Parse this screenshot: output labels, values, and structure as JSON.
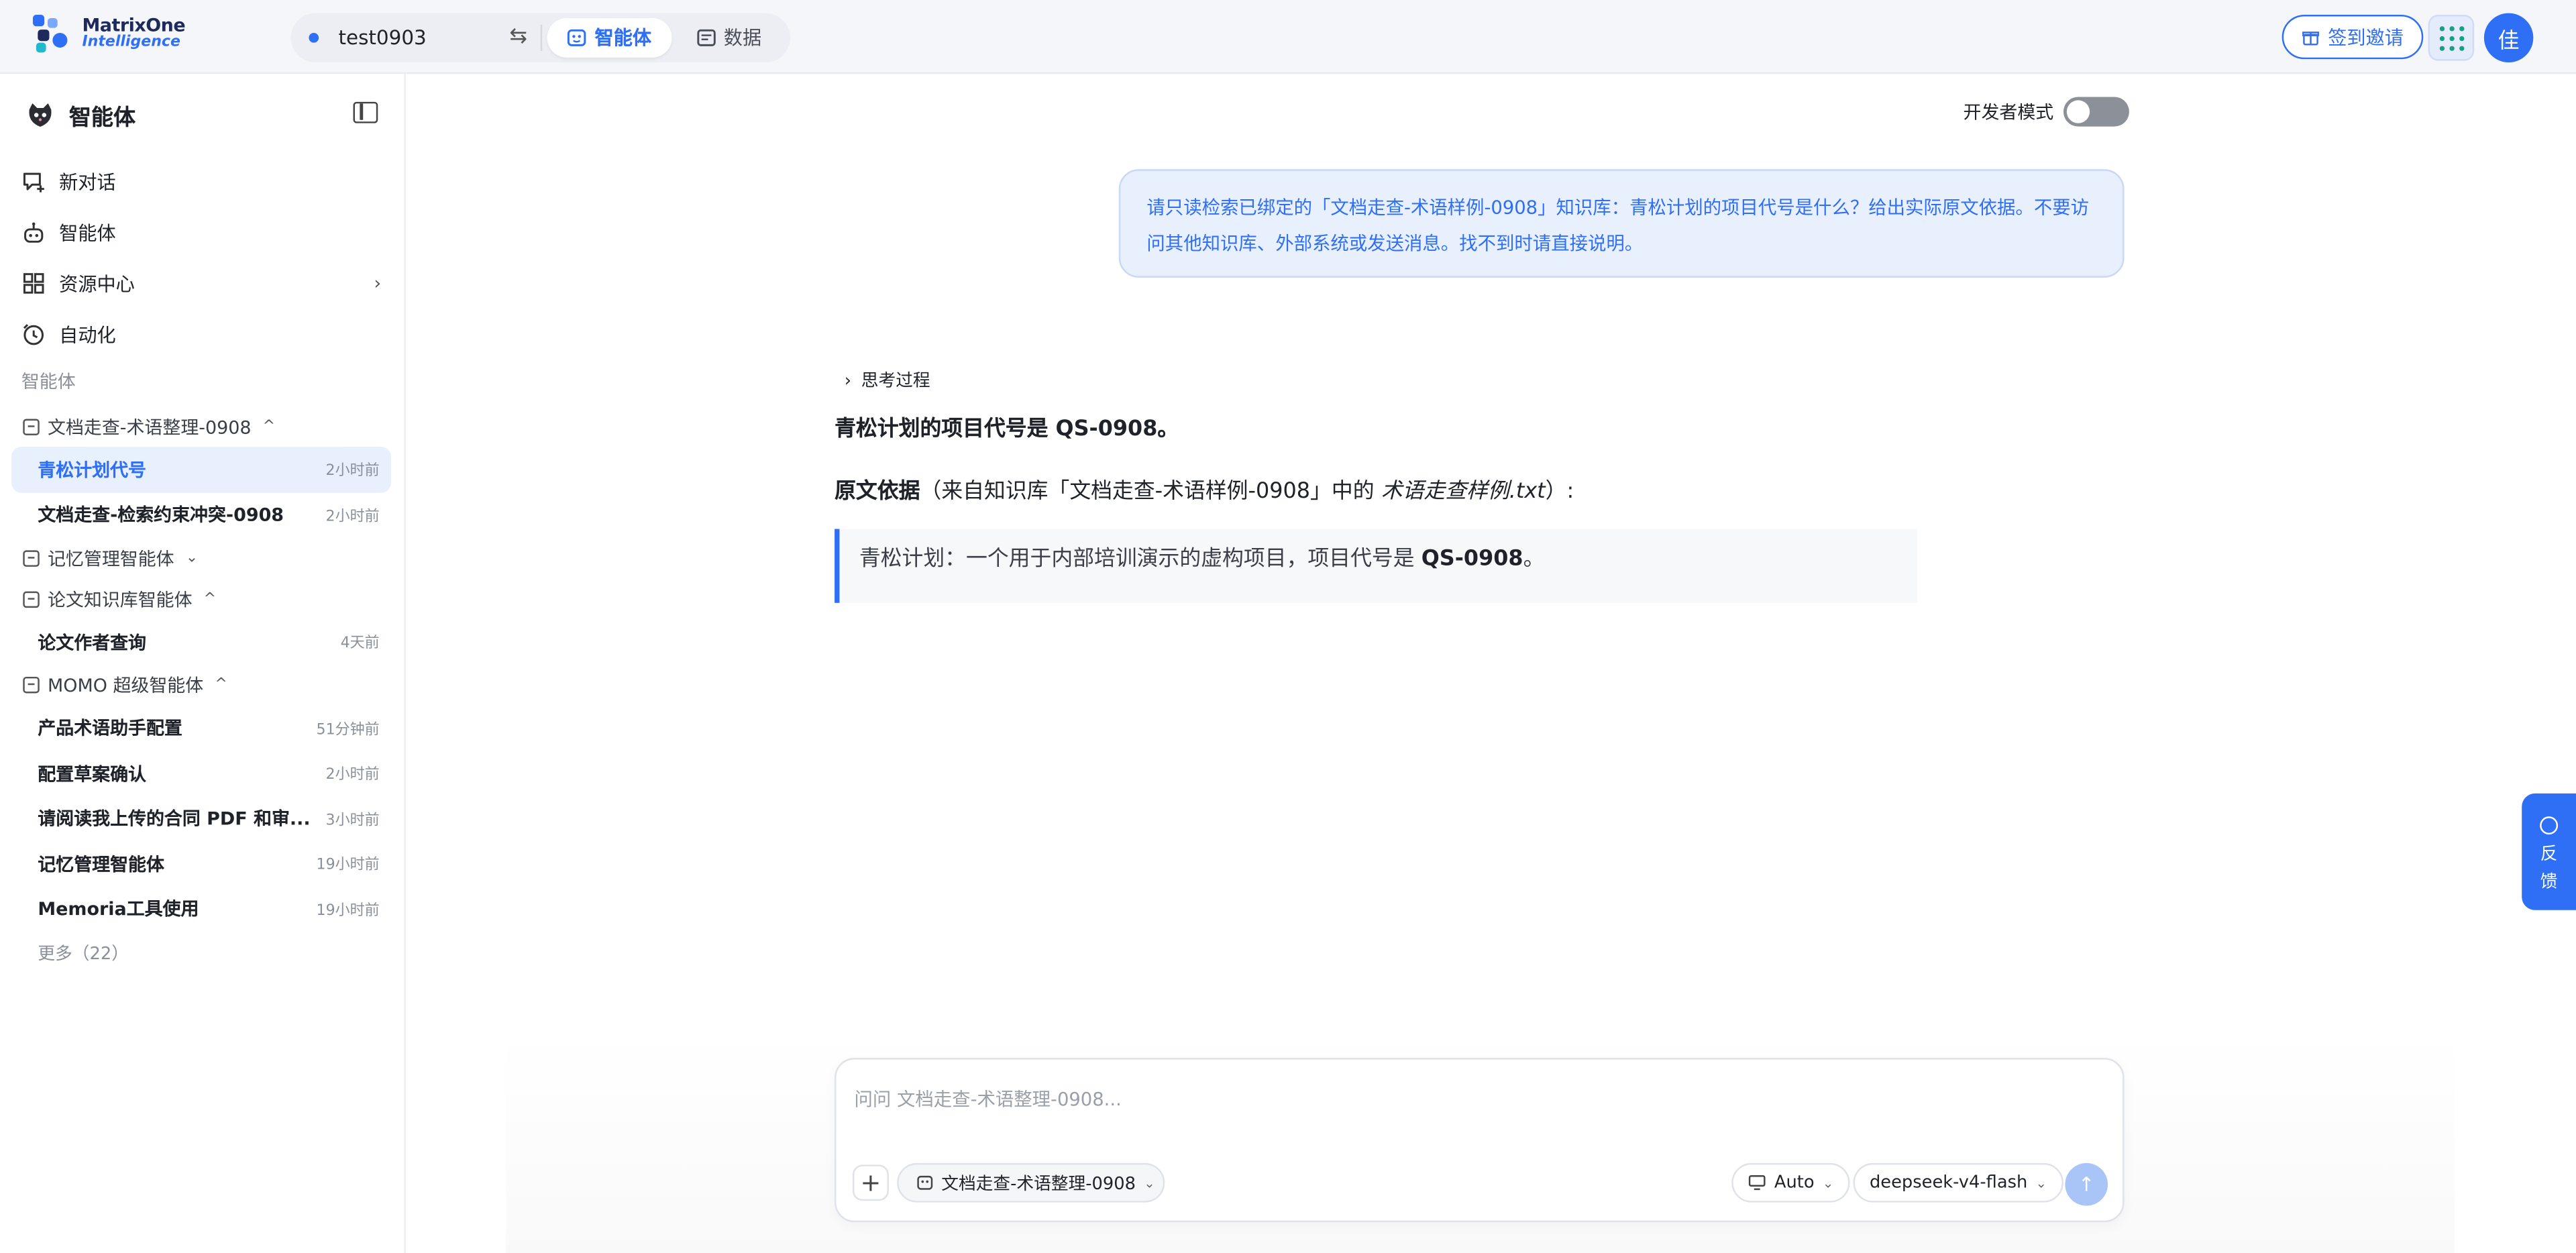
{
  "header": {
    "logo_line1": "MatrixOne",
    "logo_line2": "Intelligence",
    "workspace": "test0903",
    "tabs": [
      {
        "label": "智能体",
        "active": true
      },
      {
        "label": "数据",
        "active": false
      }
    ],
    "invite_label": "签到邀请",
    "avatar_text": "佳"
  },
  "sidebar": {
    "title": "智能体",
    "nav": [
      {
        "label": "新对话",
        "icon": "new-chat-icon"
      },
      {
        "label": "智能体",
        "icon": "robot-icon"
      },
      {
        "label": "资源中心",
        "icon": "grid-icon",
        "has_chevron": true
      },
      {
        "label": "自动化",
        "icon": "clock-icon"
      }
    ],
    "section_label": "智能体",
    "groups": [
      {
        "label": "文档走查-术语整理-0908",
        "expanded": true,
        "chats": [
          {
            "title": "青松计划代号",
            "time": "2小时前",
            "active": true
          },
          {
            "title": "文档走查-检索约束冲突-0908",
            "time": "2小时前",
            "active": false
          }
        ]
      },
      {
        "label": "记忆管理智能体",
        "expanded": false,
        "chats": []
      },
      {
        "label": "论文知识库智能体",
        "expanded": true,
        "chats": [
          {
            "title": "论文作者查询",
            "time": "4天前",
            "active": false
          }
        ]
      },
      {
        "label": "MOMO 超级智能体",
        "expanded": true,
        "chats": [
          {
            "title": "产品术语助手配置",
            "time": "51分钟前",
            "active": false
          },
          {
            "title": "配置草案确认",
            "time": "2小时前",
            "active": false
          },
          {
            "title": "请阅读我上传的合同 PDF 和审...",
            "time": "3小时前",
            "active": false
          },
          {
            "title": "记忆管理智能体",
            "time": "19小时前",
            "active": false
          },
          {
            "title": "Memoria工具使用",
            "time": "19小时前",
            "active": false
          }
        ]
      }
    ],
    "more_label": "更多（22）"
  },
  "main": {
    "dev_mode_label": "开发者模式",
    "user_message": "请只读检索已绑定的「文档走查-术语样例-0908」知识库：青松计划的项目代号是什么？给出实际原文依据。不要访问其他知识库、外部系统或发送消息。找不到时请直接说明。",
    "think_label": "思考过程",
    "answer_title": "青松计划的项目代号是 QS-0908。",
    "source_bold": "原文依据",
    "source_mid": "（来自知识库「文档走查-术语样例-0908」中的 ",
    "source_file": "术语走查样例.txt",
    "source_end": "）:",
    "quote_text": "青松计划：一个用于内部培训演示的虚构项目，项目代号是 ",
    "quote_code": "QS-0908",
    "quote_end": "。"
  },
  "composer": {
    "placeholder": "问问 文档走查-术语整理-0908...",
    "agent_chip": "文档走查-术语整理-0908",
    "mode": "Auto",
    "model": "deepseek-v4-flash"
  },
  "feedback": {
    "label1": "反",
    "label2": "馈"
  },
  "colors": {
    "accent": "#2f6ff5",
    "active_bg": "#e8effd"
  }
}
